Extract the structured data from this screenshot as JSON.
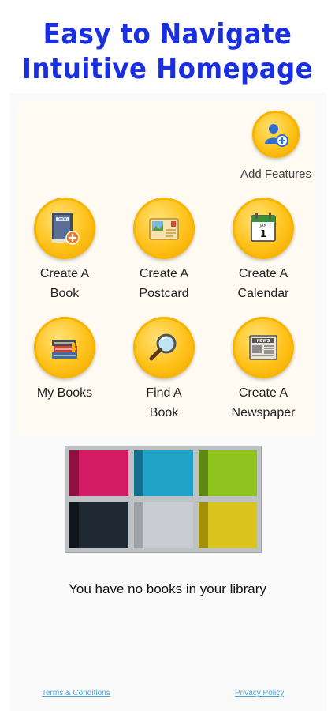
{
  "promo": {
    "line1": "Easy to Navigate",
    "line2": "Intuitive Homepage"
  },
  "add_feature": {
    "label": "Add Features",
    "icon": "add-user-icon"
  },
  "menu": [
    {
      "line1": "Create A",
      "line2": "Book",
      "icon": "book-add-icon"
    },
    {
      "line1": "Create A",
      "line2": "Postcard",
      "icon": "postcard-icon"
    },
    {
      "line1": "Create A",
      "line2": "Calendar",
      "icon": "calendar-icon"
    },
    {
      "line1": "My Books",
      "line2": "",
      "icon": "books-stack-icon"
    },
    {
      "line1": "Find A",
      "line2": "Book",
      "icon": "magnifier-icon"
    },
    {
      "line1": "Create A",
      "line2": "Newspaper",
      "icon": "newspaper-icon"
    }
  ],
  "icon_text": {
    "book_cover": "BOOK",
    "calendar_month": "JAN",
    "calendar_day": "1",
    "newspaper_head": "NEWS"
  },
  "empty_library": "You have no books in your library",
  "footer": {
    "terms": "Terms & Conditions",
    "privacy": "Privacy Policy"
  },
  "colors": {
    "promo_text": "#1a2fe0",
    "button_fill": "#ffc21a",
    "link": "#4aa3d8",
    "shelf_cubbies": [
      "#d21b63",
      "#20a3c9",
      "#8fc41f",
      "#1f2933",
      "#c9ccd0",
      "#d8c41a"
    ]
  }
}
